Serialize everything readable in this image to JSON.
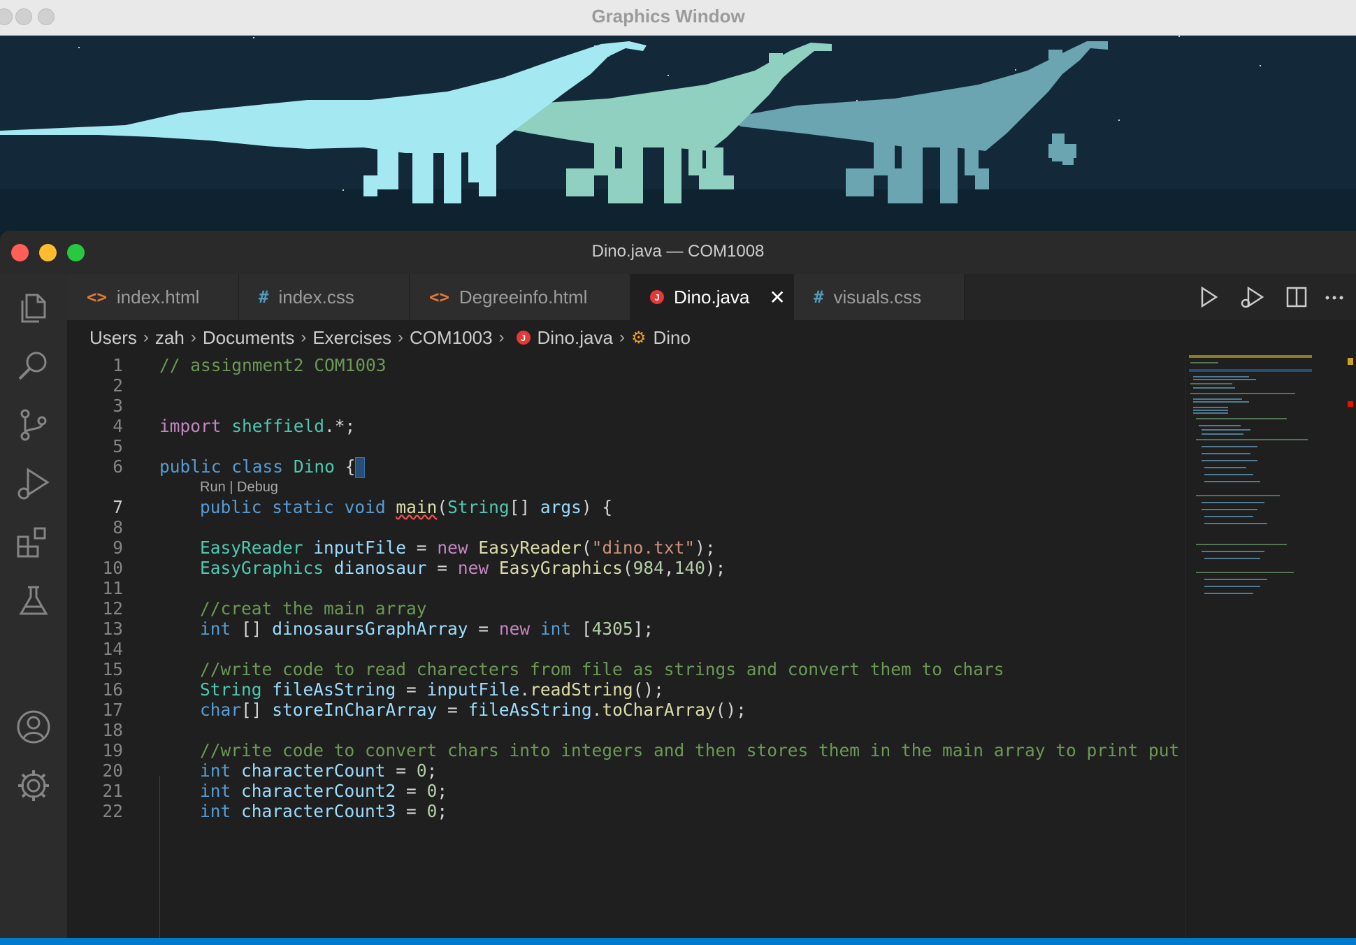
{
  "graphics_window": {
    "title": "Graphics Window",
    "colors": {
      "sky": "#132838",
      "ground": "#0e2230",
      "dino1": "#a4e8f2",
      "dino2": "#8fd0c0",
      "dino3": "#6ba5b2"
    }
  },
  "vscode": {
    "window_title": "Dino.java — COM1008",
    "tabs": [
      {
        "label": "index.html",
        "icon": "html-icon",
        "glyph": "<>",
        "color": "#e37933"
      },
      {
        "label": "index.css",
        "icon": "css-icon",
        "glyph": "#",
        "color": "#519aba"
      },
      {
        "label": "Degreeinfo.html",
        "icon": "html-icon",
        "glyph": "<>",
        "color": "#e37933"
      },
      {
        "label": "Dino.java",
        "icon": "java-icon",
        "glyph": "J",
        "color": "#e53935",
        "active": true
      },
      {
        "label": "visuals.css",
        "icon": "css-icon",
        "glyph": "#",
        "color": "#519aba"
      }
    ],
    "breadcrumb": [
      "Users",
      "zah",
      "Documents",
      "Exercises",
      "COM1003",
      "Dino.java",
      "Dino"
    ],
    "codelens": "Run | Debug",
    "current_line": 7,
    "line_numbers": [
      "1",
      "2",
      "3",
      "4",
      "5",
      "6",
      "7",
      "8",
      "9",
      "10",
      "11",
      "12",
      "13",
      "14",
      "15",
      "16",
      "17",
      "18",
      "19",
      "20",
      "21",
      "22"
    ],
    "code": {
      "l1_comment": "// assignment2 COM1003",
      "l4_import": "import",
      "l4_pkg": "sheffield",
      "l4_rest": ".*;",
      "l6_public": "public",
      "l6_class": "class",
      "l6_name": "Dino",
      "l6_brace": "{",
      "l7_public": "public",
      "l7_static": "static",
      "l7_void": "void",
      "l7_main": "main",
      "l7_open": "(",
      "l7_string": "String",
      "l7_arr": "[] ",
      "l7_args": "args",
      "l7_close": ") {",
      "l9_type": "EasyReader",
      "l9_var": "inputFile",
      "l9_eq": " = ",
      "l9_new": "new",
      "l9_ctor": "EasyReader",
      "l9_open": "(",
      "l9_str": "\"dino.txt\"",
      "l9_close": ");",
      "l10_type": "EasyGraphics",
      "l10_var": "dianosaur",
      "l10_eq": " = ",
      "l10_new": "new",
      "l10_ctor": "EasyGraphics",
      "l10_open": "(",
      "l10_n1": "984",
      "l10_comma": ",",
      "l10_n2": "140",
      "l10_close": ");",
      "l12_comment": "//creat the main array",
      "l13_int": "int",
      "l13_arr": " [] ",
      "l13_var": "dinosaursGraphArray",
      "l13_eq": " = ",
      "l13_new": "new",
      "l13_int2": "int",
      "l13_open": " [",
      "l13_num": "4305",
      "l13_close": "];",
      "l15_comment": "//write code to read charecters from file as strings and convert them to chars",
      "l16_type": "String",
      "l16_var": "fileAsString",
      "l16_eq": " = ",
      "l16_obj": "inputFile",
      "l16_dot": ".",
      "l16_fn": "readString",
      "l16_end": "();",
      "l17_type": "char",
      "l17_arr": "[] ",
      "l17_var": "storeInCharArray",
      "l17_eq": " = ",
      "l17_obj": "fileAsString",
      "l17_dot": ".",
      "l17_fn": "toCharArray",
      "l17_end": "();",
      "l19_comment": "//write code to convert chars into integers and then stores them in the main array to print put th",
      "l20_int": "int",
      "l20_var": "characterCount",
      "l20_eq": " = ",
      "l20_num": "0",
      "l20_end": ";",
      "l21_int": "int",
      "l21_var": "characterCount2",
      "l21_eq": " = ",
      "l21_num": "0",
      "l21_end": ";",
      "l22_int": "int",
      "l22_var": "characterCount3",
      "l22_eq": " = ",
      "l22_num": "0",
      "l22_end": ";"
    }
  }
}
